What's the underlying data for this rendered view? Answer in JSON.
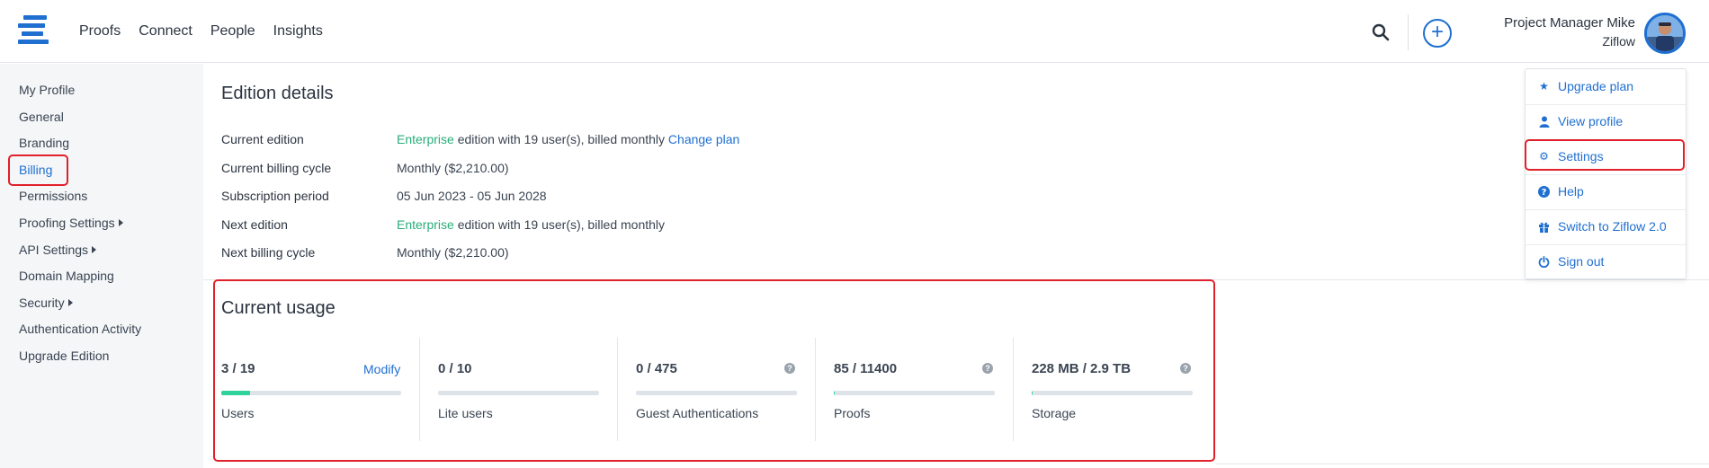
{
  "nav": {
    "items": [
      {
        "label": "Proofs"
      },
      {
        "label": "Connect"
      },
      {
        "label": "People"
      },
      {
        "label": "Insights"
      }
    ]
  },
  "user": {
    "name": "Project Manager Mike",
    "org": "Ziflow"
  },
  "icons": {
    "logo": "ziflow-logo",
    "search": "search-icon",
    "add": "plus-circle-icon",
    "help": "question-circle-icon"
  },
  "sidebar": {
    "items": [
      {
        "label": "My Profile"
      },
      {
        "label": "General"
      },
      {
        "label": "Branding"
      },
      {
        "label": "Billing",
        "active": true
      },
      {
        "label": "Permissions"
      },
      {
        "label": "Proofing Settings",
        "submenu": true
      },
      {
        "label": "API Settings",
        "submenu": true
      },
      {
        "label": "Domain Mapping"
      },
      {
        "label": "Security",
        "submenu": true
      },
      {
        "label": "Authentication Activity"
      },
      {
        "label": "Upgrade Edition"
      }
    ]
  },
  "edition": {
    "title": "Edition details",
    "rows": [
      {
        "label": "Current edition",
        "highlight": "Enterprise",
        "text": " edition with 19 user(s), billed monthly ",
        "link": "Change plan"
      },
      {
        "label": "Current billing cycle",
        "text": "Monthly ($2,210.00)"
      },
      {
        "label": "Subscription period",
        "text": "05 Jun 2023 - 05 Jun 2028"
      },
      {
        "label": "Next edition",
        "highlight": "Enterprise",
        "text": " edition with 19 user(s), billed monthly"
      },
      {
        "label": "Next billing cycle",
        "text": "Monthly ($2,210.00)"
      }
    ]
  },
  "usage": {
    "title": "Current usage",
    "modify_label": "Modify",
    "items": [
      {
        "value": "3 / 19",
        "label": "Users",
        "fill": 0.158
      },
      {
        "value": "0 / 10",
        "label": "Lite users",
        "fill": 0
      },
      {
        "value": "0 / 475",
        "label": "Guest Authentications",
        "fill": 0
      },
      {
        "value": "85 / 11400",
        "label": "Proofs",
        "fill": 0.0075
      },
      {
        "value": "228 MB / 2.9 TB",
        "label": "Storage",
        "fill": 0.0001
      }
    ]
  },
  "dropdown": {
    "items": [
      {
        "label": "Upgrade plan",
        "icon": "star-icon"
      },
      {
        "label": "View profile",
        "icon": "user-icon"
      },
      {
        "label": "Settings",
        "icon": "gear-icon"
      },
      {
        "label": "Help",
        "icon": "question-circle-icon"
      },
      {
        "label": "Switch to Ziflow 2.0",
        "icon": "gift-icon"
      },
      {
        "label": "Sign out",
        "icon": "power-icon"
      }
    ]
  },
  "colors": {
    "accent": "#1f6fd1",
    "success": "#27ae7a",
    "highlight_box": "#e0202a"
  }
}
